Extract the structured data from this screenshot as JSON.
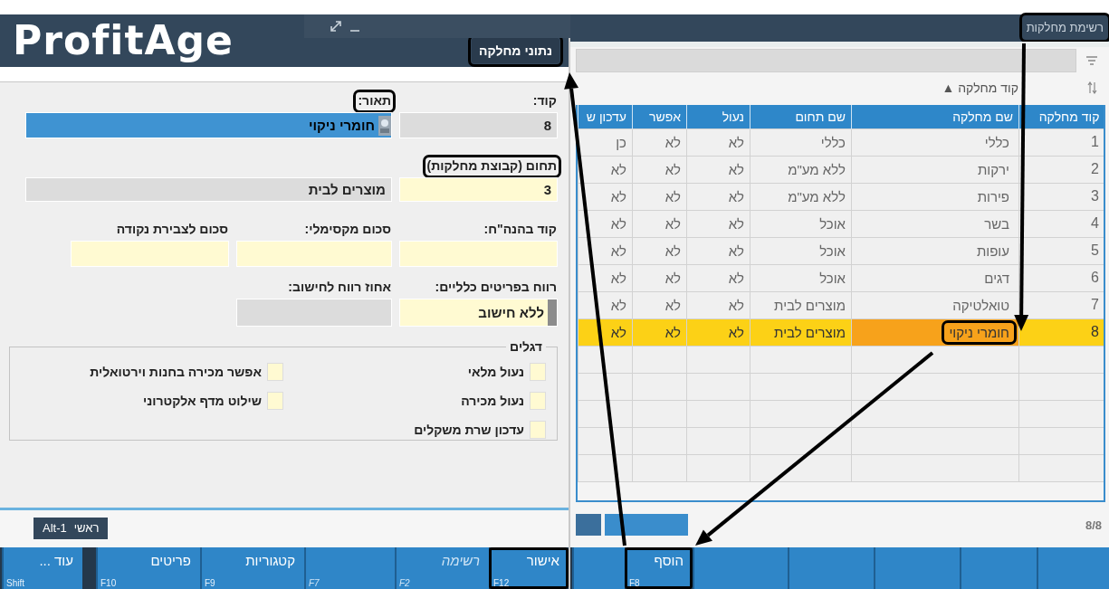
{
  "app": {
    "logo": "ProfitAge"
  },
  "detail": {
    "title": "נתוני מחלקה",
    "title_callout": true,
    "fields": [
      {
        "kind": "text",
        "label": "קוד:",
        "label_callout": false,
        "value": "8",
        "editable": false,
        "focused": false
      },
      {
        "kind": "lookup",
        "label": "תאור:",
        "label_callout": true,
        "value": "חומרי ניקוי",
        "editable": true,
        "focused": true
      },
      {
        "kind": "text",
        "label": "תחום (קבוצת מחלקות)",
        "label_callout": true,
        "value": "3",
        "editable": true,
        "focused": false
      },
      {
        "kind": "text",
        "value": "מוצרים לבית",
        "editable": false,
        "focused": false
      },
      {
        "kind": "text",
        "label": "קוד בהנה\"ח:",
        "label_callout": false,
        "editable": true,
        "focused": false
      },
      {
        "kind": "text",
        "label": "סכום מקסימלי:",
        "label_callout": false,
        "editable": true,
        "focused": false
      },
      {
        "kind": "text",
        "label": "סכום לצבירת נקודה",
        "label_callout": false,
        "editable": true,
        "focused": false
      },
      {
        "kind": "select",
        "label": "רווח בפריטים כלליים:",
        "label_callout": false,
        "value": "ללא חישוב",
        "editable": true,
        "focused": false
      },
      {
        "kind": "text",
        "label": "אחוז רווח לחישוב:",
        "label_callout": false,
        "editable": false,
        "focused": false
      }
    ],
    "flags": {
      "title": "דגלים",
      "items": [
        {
          "label": "נעול מלאי",
          "checked": false
        },
        {
          "label": "אפשר מכירה בחנות וירטואלית",
          "checked": false
        },
        {
          "label": "נעול מכירה",
          "checked": false
        },
        {
          "label": "שילוט מדף אלקטרוני",
          "checked": false
        },
        {
          "label": "עדכון שרת משקלים",
          "checked": false
        }
      ]
    },
    "tabs": [
      {
        "label": "ראשי",
        "shortcut": "Alt-1",
        "selected": true
      }
    ],
    "function_keys": [
      {
        "kind": "key",
        "label": "אישור",
        "key": "F12",
        "disabled": false,
        "callout": true
      },
      {
        "kind": "key",
        "label": "רשימה",
        "key": "F2",
        "disabled": true,
        "callout": false
      },
      {
        "kind": "key",
        "key": "F7",
        "disabled": true,
        "callout": false
      },
      {
        "kind": "key",
        "label": "קטגוריות",
        "key": "F9",
        "disabled": false,
        "callout": false
      },
      {
        "kind": "key",
        "label": "פריטים",
        "key": "F10",
        "disabled": false,
        "callout": false
      },
      {
        "kind": "more",
        "label": "עוד ...",
        "key": "Shift",
        "disabled": false,
        "callout": false
      }
    ]
  },
  "list": {
    "title": "רשימת מחלקות",
    "title_callout": true,
    "sort": {
      "label": "קוד מחלקה",
      "indicator": "▲"
    },
    "columns": [
      "קוד מחלקה",
      "שם מחלקה",
      "שם תחום",
      "נעול",
      "אפשר",
      "עדכון ש"
    ],
    "rows": [
      {
        "cells": [
          "1",
          "כללי",
          "כללי",
          "לא",
          "לא",
          "כן"
        ],
        "selected": false,
        "callout": false
      },
      {
        "cells": [
          "2",
          "ירקות",
          "ללא מע\"מ",
          "לא",
          "לא",
          "לא"
        ],
        "selected": false,
        "callout": false
      },
      {
        "cells": [
          "3",
          "פירות",
          "ללא מע\"מ",
          "לא",
          "לא",
          "לא"
        ],
        "selected": false,
        "callout": false
      },
      {
        "cells": [
          "4",
          "בשר",
          "אוכל",
          "לא",
          "לא",
          "לא"
        ],
        "selected": false,
        "callout": false
      },
      {
        "cells": [
          "5",
          "עופות",
          "אוכל",
          "לא",
          "לא",
          "לא"
        ],
        "selected": false,
        "callout": false
      },
      {
        "cells": [
          "6",
          "דגים",
          "אוכל",
          "לא",
          "לא",
          "לא"
        ],
        "selected": false,
        "callout": false
      },
      {
        "cells": [
          "7",
          "טואלטיקה",
          "מוצרים לבית",
          "לא",
          "לא",
          "לא"
        ],
        "selected": false,
        "callout": false
      },
      {
        "cells": [
          "8",
          "חומרי ניקוי",
          "מוצרים לבית",
          "לא",
          "לא",
          "לא"
        ],
        "selected": true,
        "callout": true
      }
    ],
    "count": "8/8",
    "function_keys": [
      {
        "kind": "blank"
      },
      {
        "kind": "blank"
      },
      {
        "kind": "blank"
      },
      {
        "kind": "blank"
      },
      {
        "kind": "blank"
      },
      {
        "kind": "key",
        "label": "הוסף",
        "key": "F8",
        "disabled": false,
        "callout": true
      },
      {
        "kind": "blank"
      }
    ]
  }
}
